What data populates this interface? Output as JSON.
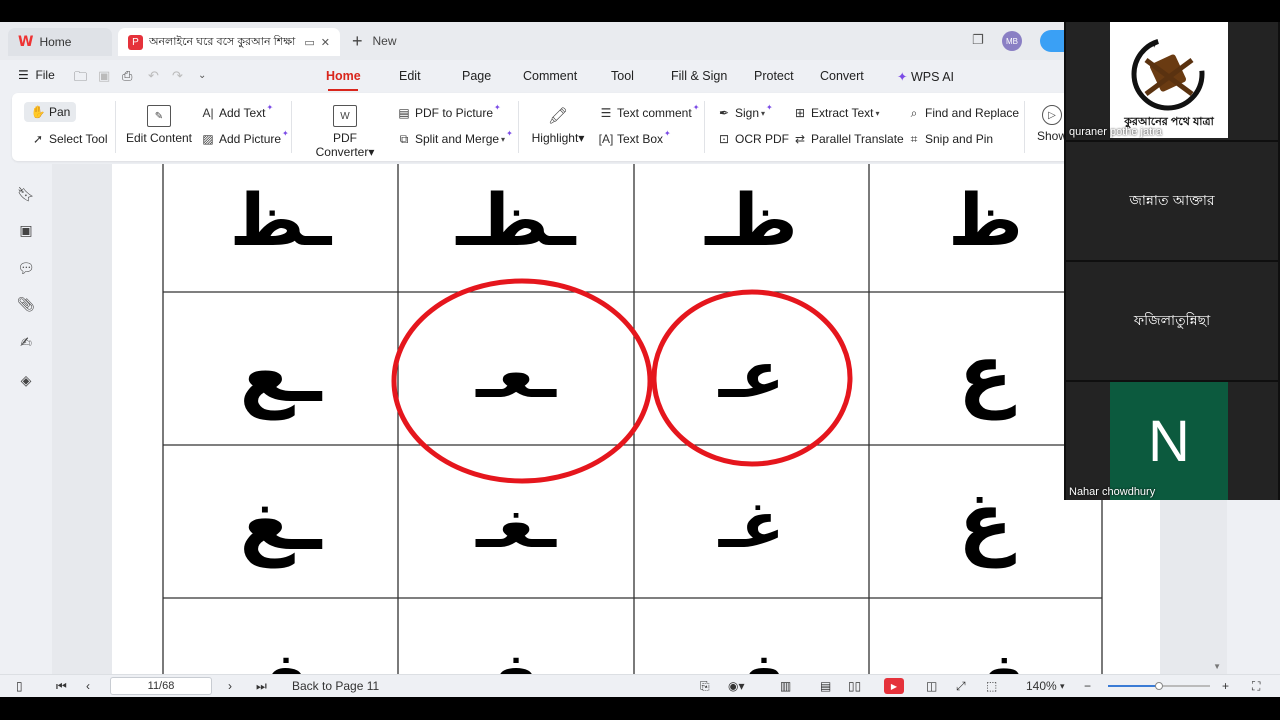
{
  "tabs": {
    "home_label": "Home",
    "doc_title": "অনলাইনে ঘরে বসে কুরআন শিক্ষা",
    "new_label": "New"
  },
  "avatar_initials": "MB",
  "menu": {
    "file": "File",
    "tabs": [
      "Home",
      "Edit",
      "Page",
      "Comment",
      "Tool",
      "Fill & Sign",
      "Protect",
      "Convert",
      "WPS AI"
    ]
  },
  "ribbon": {
    "pan": "Pan",
    "select_tool": "Select Tool",
    "edit_content": "Edit Content",
    "add_text": "Add Text",
    "add_picture": "Add Picture",
    "pdf_converter": "PDF Converter",
    "pdf_to_picture": "PDF to Picture",
    "split_merge": "Split and Merge",
    "highlight": "Highlight",
    "text_comment": "Text comment",
    "text_box": "Text Box",
    "sign": "Sign",
    "ocr_pdf": "OCR PDF",
    "extract_text": "Extract Text",
    "parallel_translate": "Parallel Translate",
    "find_replace": "Find and Replace",
    "snip_pin": "Snip and Pin",
    "show": "Show"
  },
  "document": {
    "rows": [
      [
        "ـظ",
        "ـظـ",
        "ظـ",
        "ظ"
      ],
      [
        "ـع",
        "ـعـ",
        "عـ",
        "ع"
      ],
      [
        "ـغ",
        "ـغـ",
        "غـ",
        "غ"
      ],
      [
        "ـف",
        "ـفـ",
        "فـ",
        "ف"
      ]
    ],
    "annotation_color": "#e5161d"
  },
  "statusbar": {
    "page_indicator": "11/68",
    "back_to_page": "Back to Page 11",
    "zoom": "140%",
    "zoom_level_fraction": 0.5
  },
  "participants": [
    {
      "name": "quraner pothe jatra",
      "logo_text": "কুরআনের পথে যাত্রা"
    },
    {
      "name": "জান্নাত আক্তার"
    },
    {
      "name": "ফজিলাতুন্নিছা"
    },
    {
      "name": "Nahar chowdhury",
      "initial": "N"
    }
  ]
}
